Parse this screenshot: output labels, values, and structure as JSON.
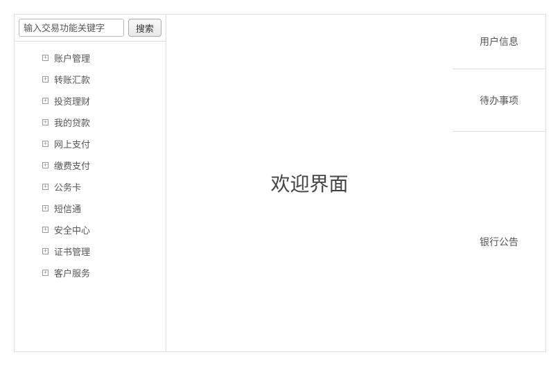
{
  "search": {
    "placeholder": "输入交易功能关键字",
    "button_label": "搜索"
  },
  "nav": {
    "items": [
      {
        "label": "账户管理"
      },
      {
        "label": "转账汇款"
      },
      {
        "label": "投资理财"
      },
      {
        "label": "我的贷款"
      },
      {
        "label": "网上支付"
      },
      {
        "label": "缴费支付"
      },
      {
        "label": "公务卡"
      },
      {
        "label": "短信通"
      },
      {
        "label": "安全中心"
      },
      {
        "label": "证书管理"
      },
      {
        "label": "客户服务"
      }
    ]
  },
  "main": {
    "welcome_title": "欢迎界面"
  },
  "right": {
    "user_info_label": "用户信息",
    "todo_label": "待办事项",
    "bank_notice_label": "银行公告"
  }
}
